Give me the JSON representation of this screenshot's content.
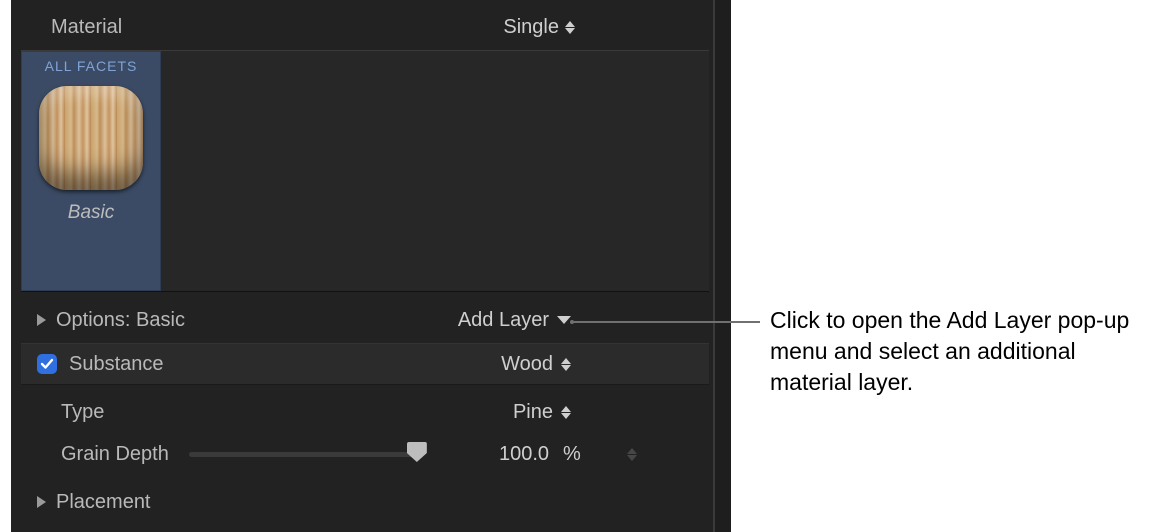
{
  "header": {
    "material_label": "Material",
    "material_mode": "Single"
  },
  "facets": {
    "tab_label": "ALL FACETS",
    "caption": "Basic"
  },
  "options": {
    "label": "Options: Basic",
    "add_layer_label": "Add Layer"
  },
  "substance": {
    "label": "Substance",
    "value": "Wood",
    "checked": true
  },
  "type": {
    "label": "Type",
    "value": "Pine"
  },
  "grain": {
    "label": "Grain Depth",
    "value_text": "100.0",
    "unit": "%",
    "percent": 100
  },
  "placement": {
    "label": "Placement"
  },
  "callout": {
    "text": "Click to open the Add Layer pop-up menu and select an additional material layer."
  }
}
